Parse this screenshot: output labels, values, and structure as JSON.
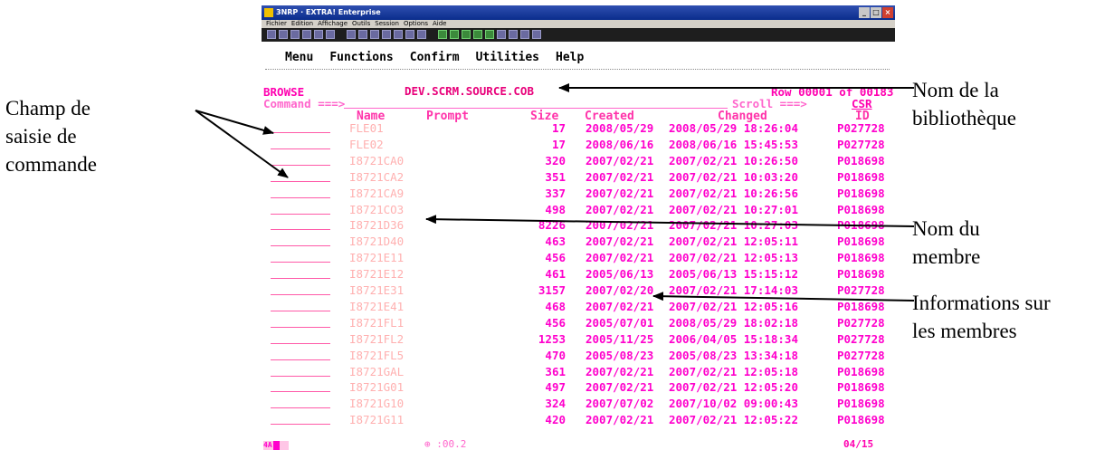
{
  "window": {
    "title": "3NRP · EXTRA! Enterprise",
    "menubar": [
      "Fichier",
      "Edition",
      "Affichage",
      "Outils",
      "Session",
      "Options",
      "Aide"
    ]
  },
  "ispf_menu": [
    "Menu",
    "Functions",
    "Confirm",
    "Utilities",
    "Help"
  ],
  "panel": {
    "mode": "BROWSE",
    "dataset": "DEV.SCRM.SOURCE.COB",
    "row_info": "Row 00001 of 00183",
    "command_label": "Command ===>",
    "scroll_label": "Scroll ===>",
    "scroll_value": "CSR"
  },
  "table": {
    "columns": [
      "Name",
      "Prompt",
      "Size",
      "Created",
      "Changed",
      "ID"
    ],
    "rows": [
      [
        "FLE01",
        "17",
        "2008/05/29",
        "2008/05/29 18:26:04",
        "P027728"
      ],
      [
        "FLE02",
        "17",
        "2008/06/16",
        "2008/06/16 15:45:53",
        "P027728"
      ],
      [
        "I8721CA0",
        "320",
        "2007/02/21",
        "2007/02/21 10:26:50",
        "P018698"
      ],
      [
        "I8721CA2",
        "351",
        "2007/02/21",
        "2007/02/21 10:03:20",
        "P018698"
      ],
      [
        "I8721CA9",
        "337",
        "2007/02/21",
        "2007/02/21 10:26:56",
        "P018698"
      ],
      [
        "I8721CO3",
        "498",
        "2007/02/21",
        "2007/02/21 10:27:01",
        "P018698"
      ],
      [
        "I8721D36",
        "8226",
        "2007/02/21",
        "2007/02/21 10:27:03",
        "P018698"
      ],
      [
        "I8721D40",
        "463",
        "2007/02/21",
        "2007/02/21 12:05:11",
        "P018698"
      ],
      [
        "I8721E11",
        "456",
        "2007/02/21",
        "2007/02/21 12:05:13",
        "P018698"
      ],
      [
        "I8721E12",
        "461",
        "2005/06/13",
        "2005/06/13 15:15:12",
        "P018698"
      ],
      [
        "I8721E31",
        "3157",
        "2007/02/20",
        "2007/02/21 17:14:03",
        "P027728"
      ],
      [
        "I8721E41",
        "468",
        "2007/02/21",
        "2007/02/21 12:05:16",
        "P018698"
      ],
      [
        "I8721FL1",
        "456",
        "2005/07/01",
        "2008/05/29 18:02:18",
        "P027728"
      ],
      [
        "I8721FL2",
        "1253",
        "2005/11/25",
        "2006/04/05 15:18:34",
        "P027728"
      ],
      [
        "I8721FL5",
        "470",
        "2005/08/23",
        "2005/08/23 13:34:18",
        "P027728"
      ],
      [
        "I8721GAL",
        "361",
        "2007/02/21",
        "2007/02/21 12:05:18",
        "P018698"
      ],
      [
        "I8721G01",
        "497",
        "2007/02/21",
        "2007/02/21 12:05:20",
        "P018698"
      ],
      [
        "I8721G10",
        "324",
        "2007/07/02",
        "2007/10/02 09:00:43",
        "P018698"
      ],
      [
        "I8721G11",
        "420",
        "2007/02/21",
        "2007/02/21 12:05:22",
        "P018698"
      ]
    ]
  },
  "status": {
    "prefix": "4A",
    "elapsed": "⊕ :00.2",
    "page": "04/15"
  },
  "annotations": {
    "command_field": "Champ de\nsaisie de\ncommande",
    "library_name": "Nom de la\nbibliothèque",
    "member_name": "Nom du\nmembre",
    "member_info": "Informations sur\nles membres"
  },
  "colors": {
    "text_pink": "#ff00cc",
    "name_pink": "#ffb0b0",
    "header_pink": "#ff33aa",
    "titlebar_blue": "#0a2d8c"
  }
}
